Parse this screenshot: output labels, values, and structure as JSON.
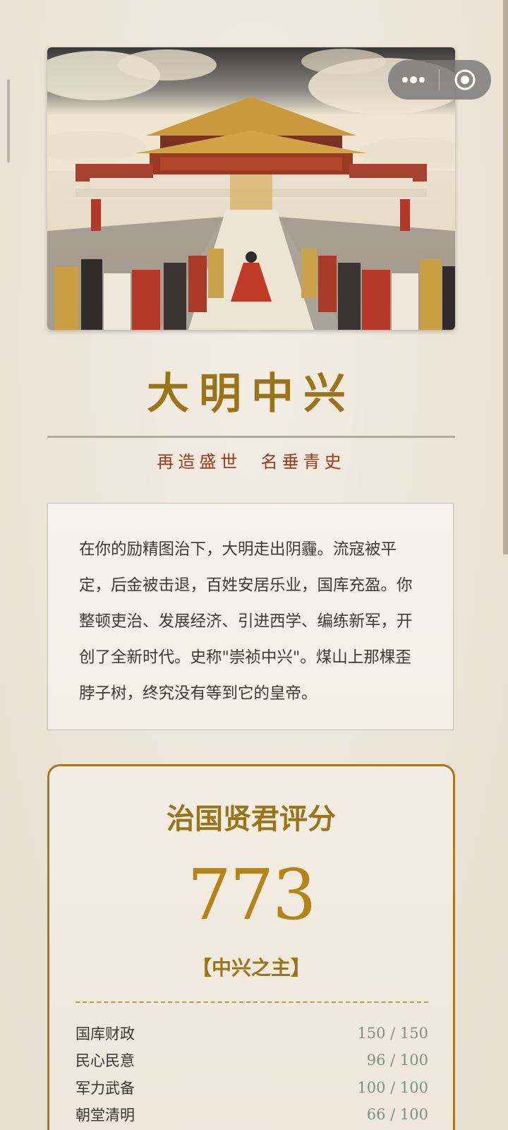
{
  "hero": {
    "image_description": "ink-wash painting of the imperial palace hall with court officials lining the path to the emperor"
  },
  "capsule": {
    "more_icon": "more-dots-icon",
    "close_icon": "target-close-icon"
  },
  "ending": {
    "title": "大明中兴",
    "subtitle": "再造盛世  名垂青史",
    "story": "在你的励精图治下，大明走出阴霾。流寇被平定，后金被击退，百姓安居乐业，国库充盈。你整顿吏治、发展经济、引进西学、编练新军，开创了全新时代。史称\"崇祯中兴\"。煤山上那棵歪脖子树，终究没有等到它的皇帝。"
  },
  "score": {
    "title": "治国贤君评分",
    "value": "773",
    "rank": "【中兴之主】",
    "stats": [
      {
        "name": "国库财政",
        "value": "150 / 150"
      },
      {
        "name": "民心民意",
        "value": "96 / 100"
      },
      {
        "name": "军力武备",
        "value": "100 / 100"
      },
      {
        "name": "朝堂清明",
        "value": "66 / 100"
      }
    ]
  },
  "colors": {
    "gold": "#9a7418",
    "red": "#9b3a20",
    "stat_value": "#7e9282"
  }
}
